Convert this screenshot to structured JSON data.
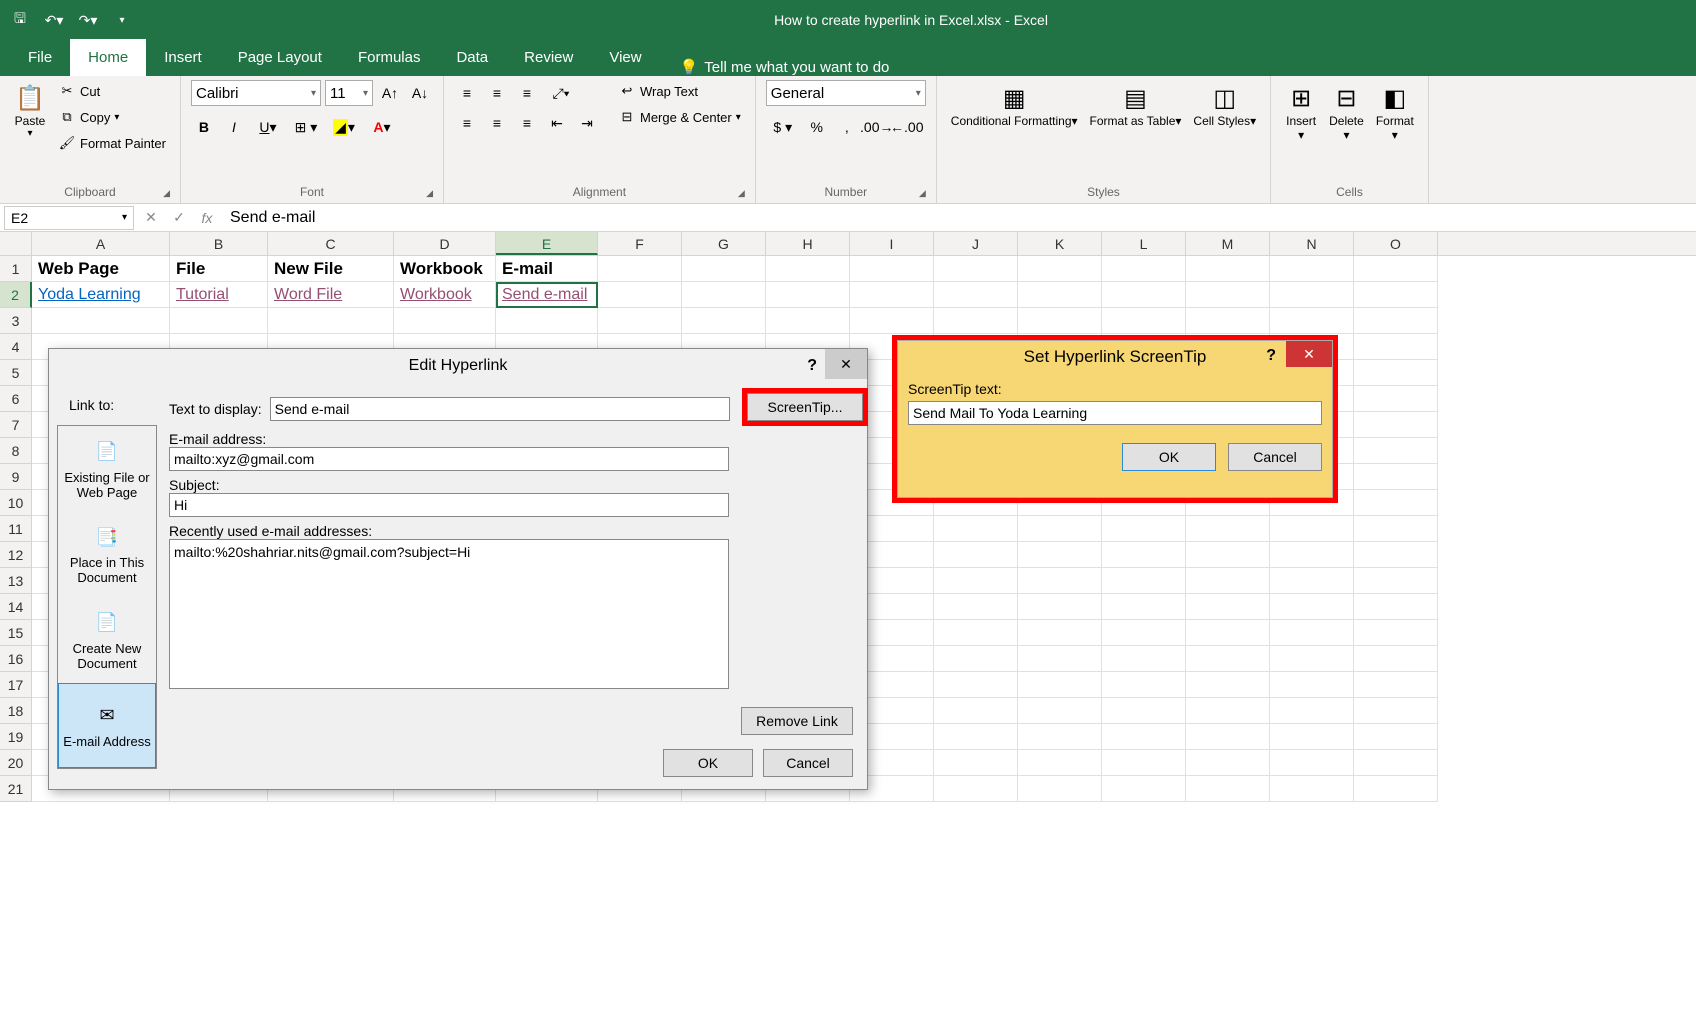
{
  "titlebar": {
    "title": "How to create hyperlink in Excel.xlsx - Excel"
  },
  "tabs": {
    "file": "File",
    "home": "Home",
    "insert": "Insert",
    "pagelayout": "Page Layout",
    "formulas": "Formulas",
    "data": "Data",
    "review": "Review",
    "view": "View",
    "tellme": "Tell me what you want to do"
  },
  "ribbon": {
    "clipboard": {
      "paste": "Paste",
      "cut": "Cut",
      "copy": "Copy",
      "formatpainter": "Format Painter",
      "group": "Clipboard"
    },
    "font": {
      "name": "Calibri",
      "size": "11",
      "group": "Font"
    },
    "alignment": {
      "wraptext": "Wrap Text",
      "mergecenter": "Merge & Center",
      "group": "Alignment"
    },
    "number": {
      "format": "General",
      "group": "Number"
    },
    "styles": {
      "condfmt": "Conditional Formatting",
      "formatastable": "Format as Table",
      "cellstyles": "Cell Styles",
      "group": "Styles"
    },
    "cells": {
      "insert": "Insert",
      "delete": "Delete",
      "format": "Format",
      "group": "Cells"
    }
  },
  "formulabar": {
    "namebox": "E2",
    "value": "Send e-mail"
  },
  "columns": [
    "A",
    "B",
    "C",
    "D",
    "E",
    "F",
    "G",
    "H",
    "I",
    "J",
    "K",
    "L",
    "M",
    "N",
    "O"
  ],
  "data_rows": [
    {
      "n": 1,
      "cells": [
        "Web Page",
        "File",
        "New File",
        "Workbook",
        "E-mail"
      ],
      "style": "bold"
    },
    {
      "n": 2,
      "cells": [
        "Yoda Learning",
        "Tutorial",
        "Word File",
        "Workbook",
        "Send e-mail"
      ],
      "styles": [
        "link",
        "linkv",
        "linkv",
        "linkv",
        "linkv"
      ]
    }
  ],
  "dialog": {
    "title": "Edit Hyperlink",
    "linkto_label": "Link to:",
    "linkto": {
      "existing": "Existing File or Web Page",
      "place": "Place in This Document",
      "createnew": "Create New Document",
      "email": "E-mail Address"
    },
    "textdisplay_label": "Text to display:",
    "textdisplay": "Send e-mail",
    "screentip": "ScreenTip...",
    "email_label": "E-mail address:",
    "email": "mailto:xyz@gmail.com",
    "subject_label": "Subject:",
    "subject": "Hi",
    "recent_label": "Recently used e-mail addresses:",
    "recent_item": "mailto:%20shahriar.nits@gmail.com?subject=Hi",
    "removelink": "Remove Link",
    "ok": "OK",
    "cancel": "Cancel"
  },
  "tipdialog": {
    "title": "Set Hyperlink ScreenTip",
    "label": "ScreenTip text:",
    "value": "Send Mail To Yoda Learning",
    "ok": "OK",
    "cancel": "Cancel"
  }
}
